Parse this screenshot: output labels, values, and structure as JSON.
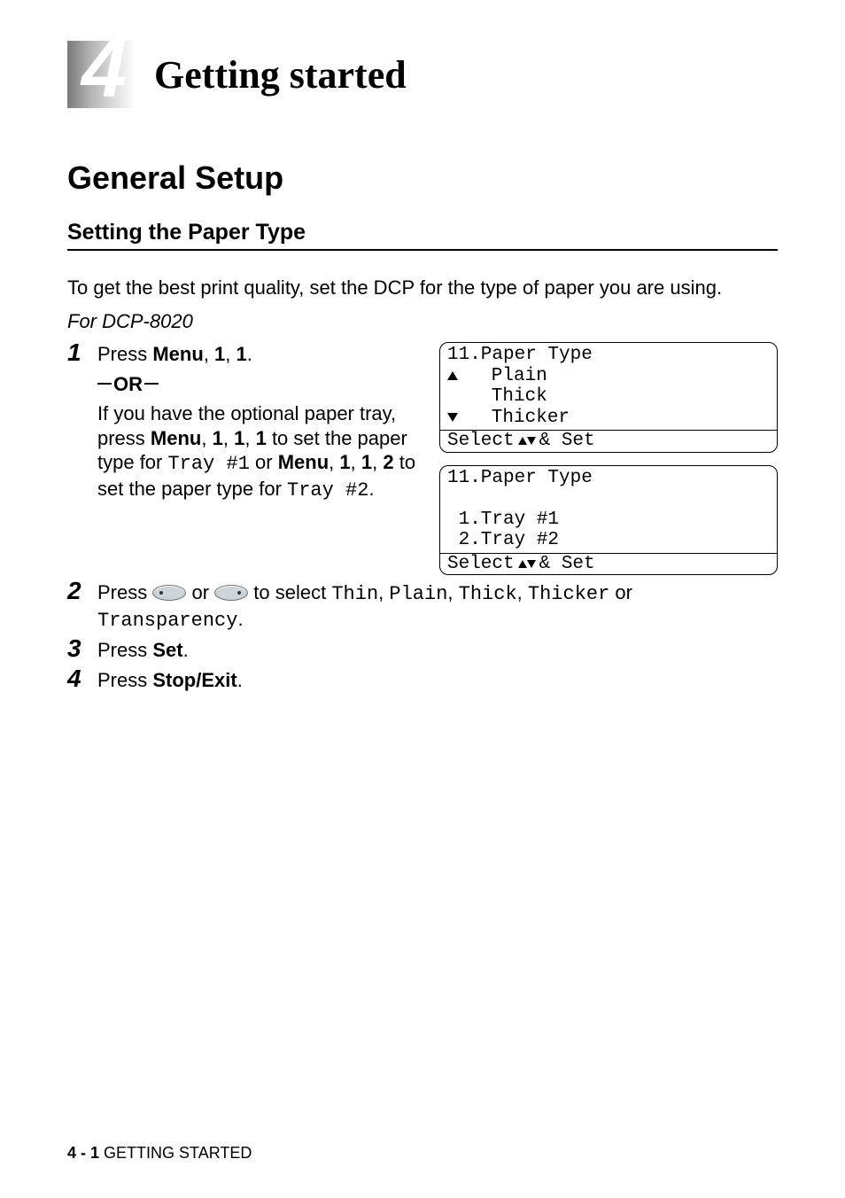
{
  "chapter": {
    "number": "4",
    "title": "Getting started"
  },
  "section": {
    "h1": "General Setup",
    "h2": "Setting the Paper Type"
  },
  "intro": "To get the best print quality, set the DCP for the type of paper you are using.",
  "model_note": "For DCP-8020",
  "steps": {
    "s1": {
      "num": "1",
      "press": "Press ",
      "menu": "Menu",
      "seq1": ", ",
      "b1": "1",
      "seq2": ", ",
      "b2": "1",
      "period": ".",
      "or": "OR",
      "line2a": "If you have the optional paper tray, press ",
      "menu2": "Menu",
      "c1": ", ",
      "d1": "1",
      "c2": ", ",
      "d2": "1",
      "c3": ", ",
      "d3": "1",
      "line2b": " to set the paper type for ",
      "tray1": "Tray #1",
      "line2c": " or ",
      "menu3": "Menu",
      "e1": ", ",
      "f1": "1",
      "e2": ", ",
      "f2": "1",
      "e3": ", ",
      "f3": "2",
      "line2d": " to set the paper type for ",
      "tray2": "Tray #2",
      "end": "."
    },
    "s2": {
      "num": "2",
      "a": "Press ",
      "b": " or ",
      "c": " to select ",
      "opt1": "Thin",
      "sep": ", ",
      "opt2": "Plain",
      "opt3": "Thick",
      "opt4": "Thicker",
      "d": " or ",
      "opt5": "Transparency",
      "e": "."
    },
    "s3": {
      "num": "3",
      "a": "Press ",
      "b": "Set",
      "c": "."
    },
    "s4": {
      "num": "4",
      "a": "Press ",
      "b": "Stop/Exit",
      "c": "."
    }
  },
  "lcd1": {
    "title": "11.Paper Type",
    "r1": "   Plain",
    "r2": "   Thick",
    "r3": "   Thicker",
    "sel_a": "Select ",
    "sel_b": " & Set"
  },
  "lcd2": {
    "title": "11.Paper Type",
    "r1": " 1.Tray #1",
    "r2": " 2.Tray #2",
    "sel_a": "Select ",
    "sel_b": " & Set"
  },
  "footer": {
    "page": "4 - 1",
    "label": "   GETTING STARTED"
  }
}
